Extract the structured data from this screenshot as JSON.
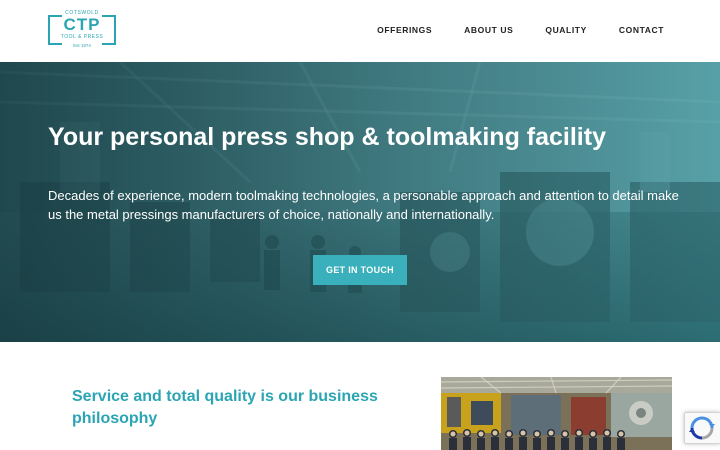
{
  "logo": {
    "top_text": "COTSWOLD",
    "main_text": "CTP",
    "sub_text": "TOOL & PRESS",
    "est_text": "Est 1974",
    "brand_color": "#2ba5b3"
  },
  "nav": {
    "items": [
      {
        "label": "OFFERINGS"
      },
      {
        "label": "ABOUT US"
      },
      {
        "label": "QUALITY"
      },
      {
        "label": "CONTACT"
      }
    ]
  },
  "hero": {
    "title": "Your personal press shop & toolmaking facility",
    "text": "Decades of experience, modern toolmaking technologies, a personable approach and attention to detail make us the metal pressings manufacturers of choice, nationally and internationally.",
    "cta_label": "GET IN TOUCH",
    "cta_color": "#39b0bb"
  },
  "section": {
    "heading": "Service and total quality is our business philosophy"
  },
  "icons": {
    "recaptcha": "recaptcha-icon"
  }
}
